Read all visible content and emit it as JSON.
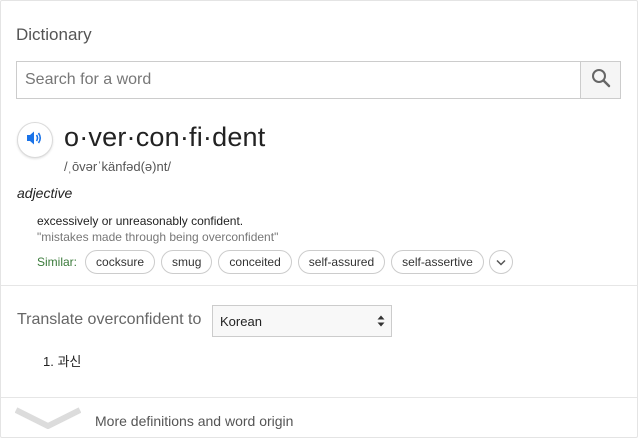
{
  "header": {
    "title": "Dictionary"
  },
  "search": {
    "placeholder": "Search for a word",
    "value": "",
    "icon": "search-icon"
  },
  "entry": {
    "word": "o·ver·con·fi·dent",
    "phonetic": "/ˌōvərˈkänfəd(ə)nt/",
    "part_of_speech": "adjective",
    "definition": "excessively or unreasonably confident.",
    "example": "\"mistakes made through being overconfident\"",
    "similar_label": "Similar:",
    "similar": [
      "cocksure",
      "smug",
      "conceited",
      "self-assured",
      "self-assertive"
    ]
  },
  "translate": {
    "label": "Translate overconfident to",
    "language": "Korean",
    "results": [
      "1. 과신"
    ]
  },
  "footer": {
    "more_label": "More definitions and word origin"
  },
  "colors": {
    "similar_label": "#3a7a3a",
    "speaker_icon": "#1a73e8"
  }
}
